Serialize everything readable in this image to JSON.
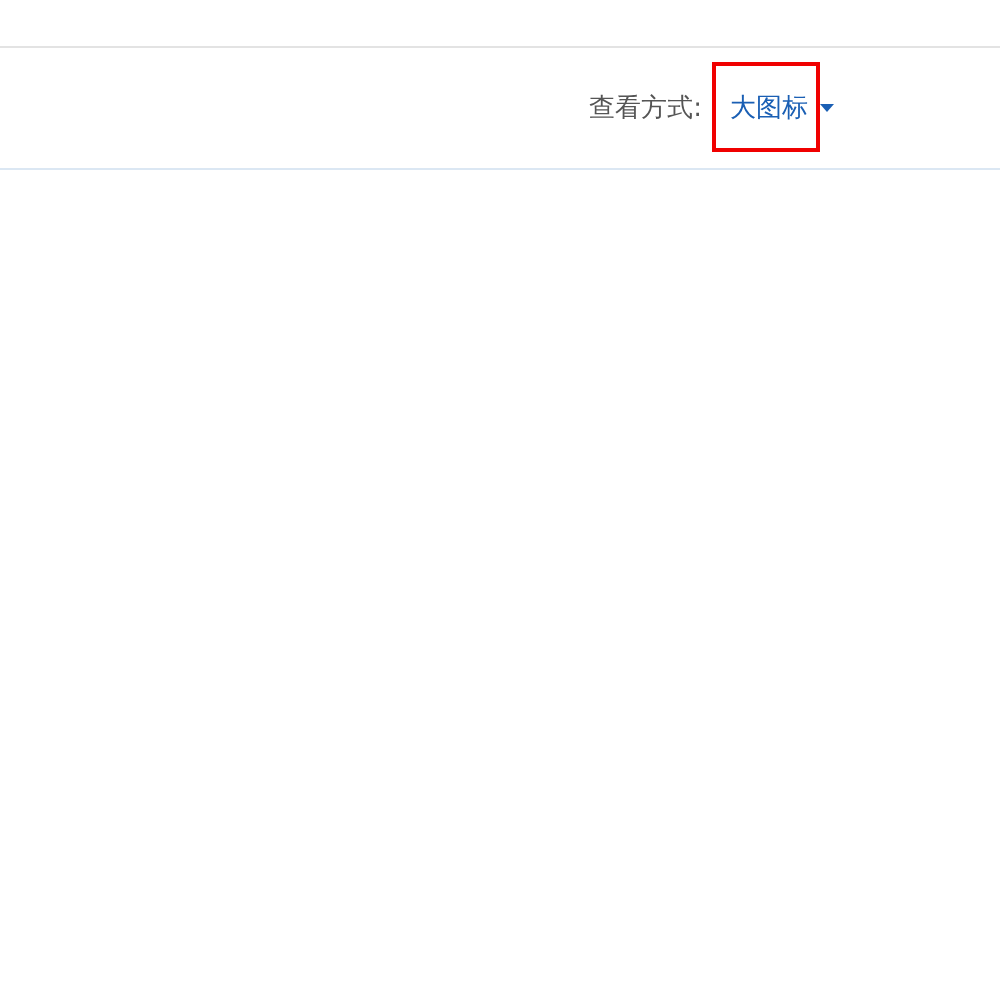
{
  "toolbar": {
    "view_label": "查看方式:",
    "view_mode": {
      "value": "大图标",
      "highlighted": true
    }
  }
}
